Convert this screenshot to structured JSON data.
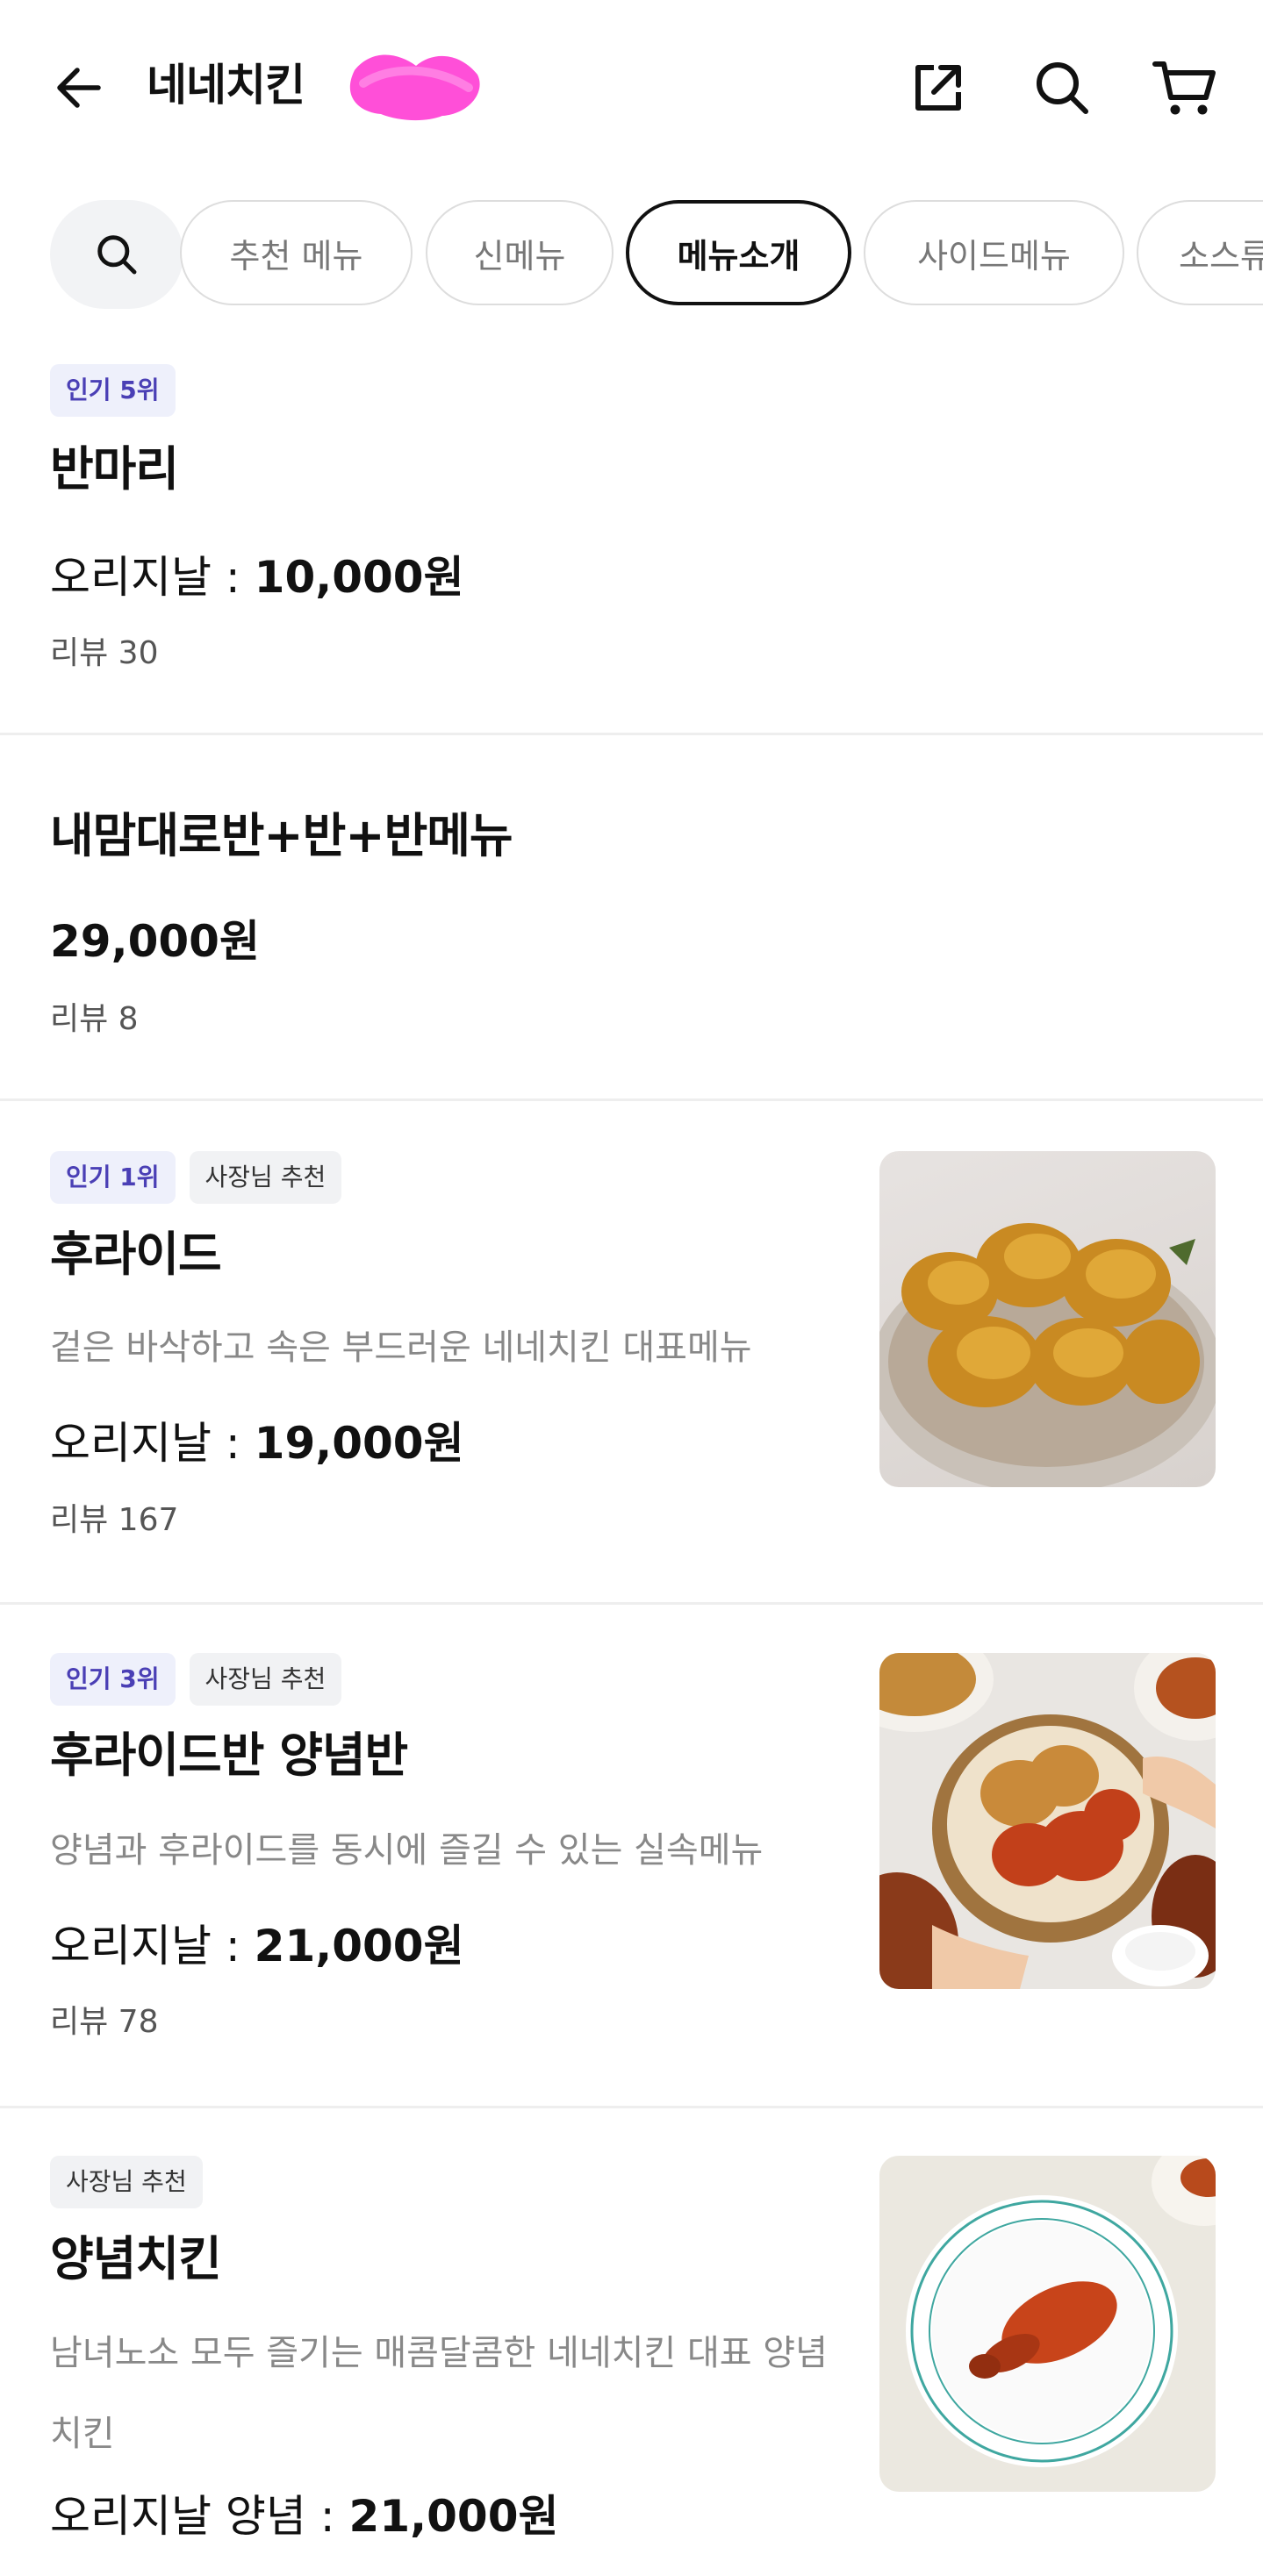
{
  "header": {
    "store_name": "네네치킨",
    "icons": {
      "back": "arrow-left-icon",
      "share": "share-icon",
      "search": "search-icon",
      "cart": "cart-icon"
    }
  },
  "tabs": {
    "items": [
      {
        "label": "추천 메뉴",
        "active": false
      },
      {
        "label": "신메뉴",
        "active": false
      },
      {
        "label": "메뉴소개",
        "active": true
      },
      {
        "label": "사이드메뉴",
        "active": false
      },
      {
        "label": "소스류",
        "active": false
      }
    ]
  },
  "items": [
    {
      "badges": [
        "인기 5위"
      ],
      "name": "반마리",
      "price_prefix": "오리지날 :",
      "price": "10,000원",
      "review": "리뷰 30"
    },
    {
      "name": "내맘대로반+반+반메뉴",
      "price": "29,000원",
      "review": "리뷰 8"
    },
    {
      "badges": [
        "인기 1위",
        "사장님 추천"
      ],
      "name": "후라이드",
      "description": "겉은 바삭하고 속은 부드러운 네네치킨 대표메뉴",
      "price_prefix": "오리지날 :",
      "price": "19,000원",
      "review": "리뷰 167"
    },
    {
      "badges": [
        "인기 3위",
        "사장님 추천"
      ],
      "name": "후라이드반 양념반",
      "description": "양념과 후라이드를 동시에 즐길 수 있는 실속메뉴",
      "price_prefix": "오리지날 :",
      "price": "21,000원",
      "review": "리뷰 78"
    },
    {
      "badges": [
        "사장님 추천"
      ],
      "name": "양념치킨",
      "description": "남녀노소 모두 즐기는 매콤달콤한 네네치킨 대표 양념치킨",
      "price_prefix": "오리지날 양념 :",
      "price": "21,000원"
    }
  ],
  "colors": {
    "popular_badge_bg": "#eef0fb",
    "popular_badge_text": "#4a3fb5",
    "owner_badge_bg": "#f1f2f4",
    "active_tab_border": "#111111",
    "redaction": "#ff4fd8"
  }
}
